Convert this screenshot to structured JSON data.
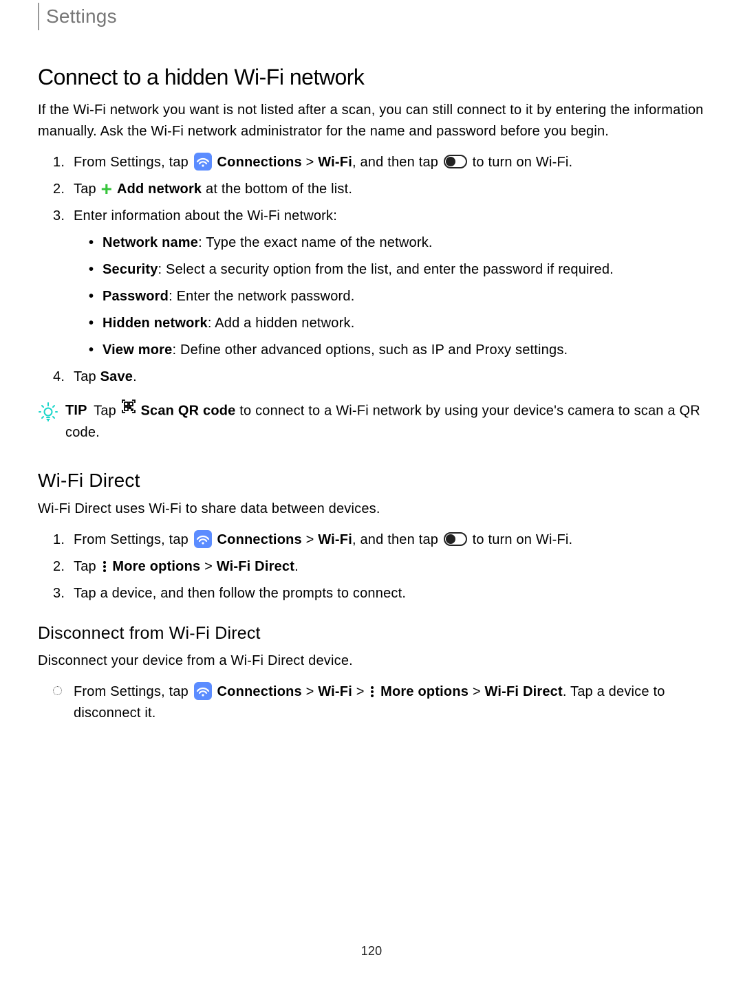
{
  "header": {
    "breadcrumb": "Settings"
  },
  "section1": {
    "title": "Connect to a hidden Wi-Fi network",
    "intro": "If the Wi-Fi network you want is not listed after a scan, you can still connect to it by entering the information manually. Ask the Wi-Fi network administrator for the name and password before you begin.",
    "step1_a": "From Settings, tap ",
    "step1_conn": "Connections",
    "step1_gt": " > ",
    "step1_wifi": "Wi-Fi",
    "step1_b": ", and then tap ",
    "step1_c": " to turn on Wi-Fi.",
    "step2_a": "Tap ",
    "step2_add": "Add network",
    "step2_b": " at the bottom of the list.",
    "step3": "Enter information about the Wi-Fi network:",
    "b_netname_l": "Network name",
    "b_netname_t": ": Type the exact name of the network.",
    "b_sec_l": "Security",
    "b_sec_t": ": Select a security option from the list, and enter the password if required.",
    "b_pass_l": "Password",
    "b_pass_t": ": Enter the network password.",
    "b_hid_l": "Hidden network",
    "b_hid_t": ": Add a hidden network.",
    "b_view_l": "View more",
    "b_view_t": ": Define other advanced options, such as IP and Proxy settings.",
    "step4_a": "Tap ",
    "step4_save": "Save",
    "step4_b": ".",
    "tip_label": "TIP",
    "tip_a": "Tap ",
    "tip_scan": "Scan QR code",
    "tip_b": " to connect to a Wi-Fi network by using your device's camera to scan a QR code."
  },
  "section2": {
    "title": "Wi-Fi Direct",
    "intro": "Wi-Fi Direct uses Wi-Fi to share data between devices.",
    "step1_a": "From Settings, tap ",
    "step1_conn": "Connections",
    "step1_gt": " > ",
    "step1_wifi": "Wi-Fi",
    "step1_b": ", and then tap ",
    "step1_c": " to turn on Wi-Fi.",
    "step2_a": "Tap ",
    "step2_more": "More options",
    "step2_gt": " > ",
    "step2_wfd": "Wi-Fi Direct",
    "step2_b": ".",
    "step3": "Tap a device, and then follow the prompts to connect."
  },
  "section3": {
    "title": "Disconnect from Wi-Fi Direct",
    "intro": "Disconnect your device from a Wi-Fi Direct device.",
    "li_a": "From Settings, tap ",
    "li_conn": "Connections",
    "li_gt1": " > ",
    "li_wifi": "Wi-Fi",
    "li_gt2": " > ",
    "li_more": "More options",
    "li_gt3": " > ",
    "li_wfd": "Wi-Fi Direct",
    "li_b": ". Tap a device to disconnect it."
  },
  "page_number": "120"
}
